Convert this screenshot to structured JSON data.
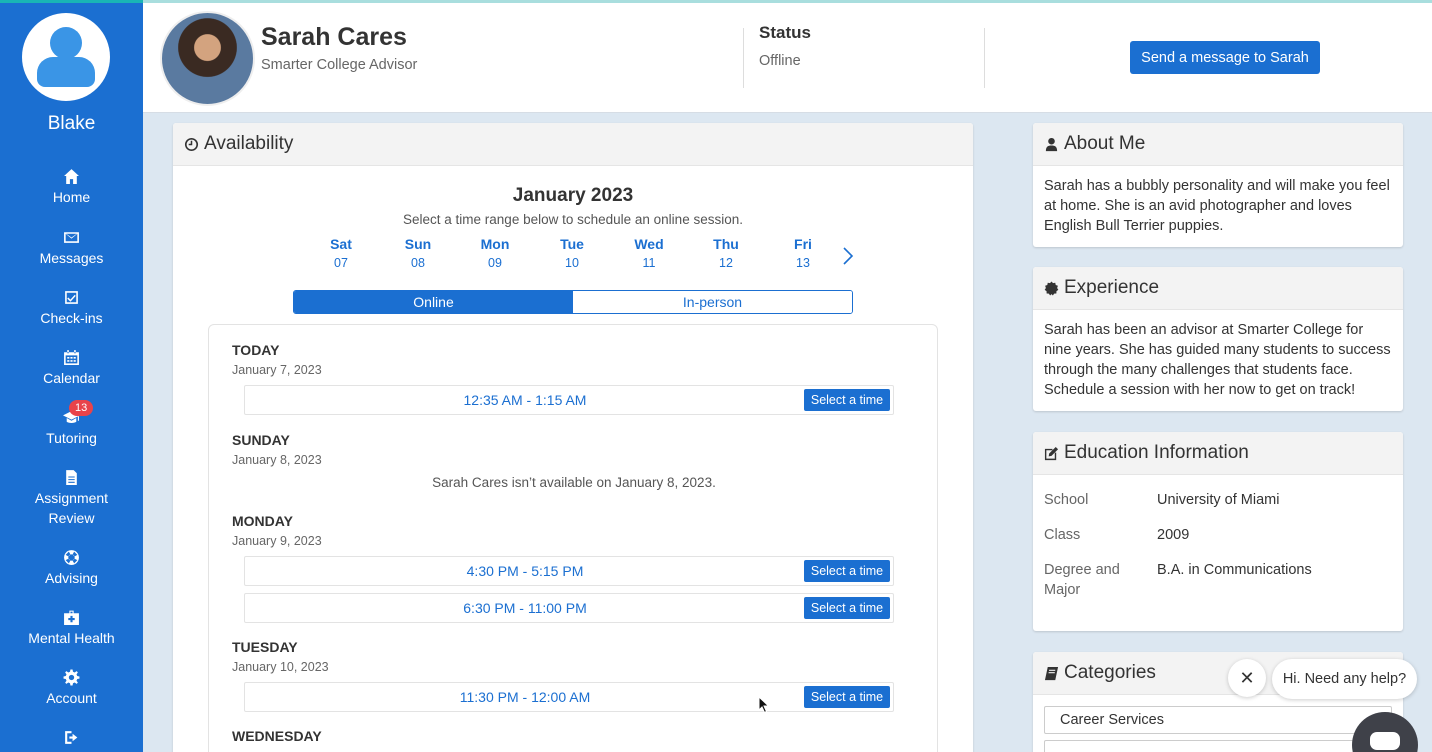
{
  "sidebar": {
    "user_name": "Blake",
    "items": [
      {
        "label": "Home",
        "icon": "home-icon"
      },
      {
        "label": "Messages",
        "icon": "envelope-icon"
      },
      {
        "label": "Check-ins",
        "icon": "checkbox-icon"
      },
      {
        "label": "Calendar",
        "icon": "calendar-icon"
      },
      {
        "label": "Tutoring",
        "icon": "graduation-cap-icon",
        "badge": "13"
      },
      {
        "label": "Assignment Review",
        "icon": "document-icon"
      },
      {
        "label": "Advising",
        "icon": "lifebuoy-icon"
      },
      {
        "label": "Mental Health",
        "icon": "medkit-icon"
      },
      {
        "label": "Account",
        "icon": "gear-icon"
      },
      {
        "label": "",
        "icon": "sign-out-icon"
      }
    ]
  },
  "header": {
    "name": "Sarah Cares",
    "role": "Smarter College Advisor",
    "status_label": "Status",
    "status_value": "Offline",
    "message_button": "Send a message to Sarah"
  },
  "availability": {
    "title": "Availability",
    "month": "January 2023",
    "instruction": "Select a time range below to schedule an online session.",
    "days": [
      {
        "name": "Sat",
        "date": "07"
      },
      {
        "name": "Sun",
        "date": "08"
      },
      {
        "name": "Mon",
        "date": "09"
      },
      {
        "name": "Tue",
        "date": "10"
      },
      {
        "name": "Wed",
        "date": "11"
      },
      {
        "name": "Thu",
        "date": "12"
      },
      {
        "name": "Fri",
        "date": "13"
      }
    ],
    "mode_online": "Online",
    "mode_inperson": "In-person",
    "select_label": "Select a time",
    "schedule": [
      {
        "title": "TODAY",
        "date": "January 7, 2023",
        "slots": [
          "12:35 AM - 1:15 AM"
        ]
      },
      {
        "title": "SUNDAY",
        "date": "January 8, 2023",
        "note": "Sarah Cares isn’t available on January 8, 2023."
      },
      {
        "title": "MONDAY",
        "date": "January 9, 2023",
        "slots": [
          "4:30 PM - 5:15 PM",
          "6:30 PM - 11:00 PM"
        ]
      },
      {
        "title": "TUESDAY",
        "date": "January 10, 2023",
        "slots": [
          "11:30 PM - 12:00 AM"
        ]
      },
      {
        "title": "WEDNESDAY"
      }
    ]
  },
  "about": {
    "title": "About Me",
    "text": "Sarah has a bubbly personality and will make you feel at home. She is an avid photographer and loves English Bull Terrier puppies."
  },
  "experience": {
    "title": "Experience",
    "text": "Sarah has been an advisor at Smarter College for nine years. She has guided many students to success through the many challenges that students face. Schedule a session with her now to get on track!"
  },
  "education": {
    "title": "Education Information",
    "rows": [
      {
        "label": "School",
        "value": "University of Miami"
      },
      {
        "label": "Class",
        "value": "2009"
      },
      {
        "label": "Degree and Major",
        "value": "B.A. in Communications"
      }
    ]
  },
  "categories": {
    "title": "Categories",
    "items": [
      "Career Services"
    ]
  },
  "chat": {
    "close": "✕",
    "prompt": "Hi. Need any help?"
  },
  "colors": {
    "primary": "#1b6fd1",
    "background": "#dce7f1",
    "badge": "#e8434a"
  }
}
